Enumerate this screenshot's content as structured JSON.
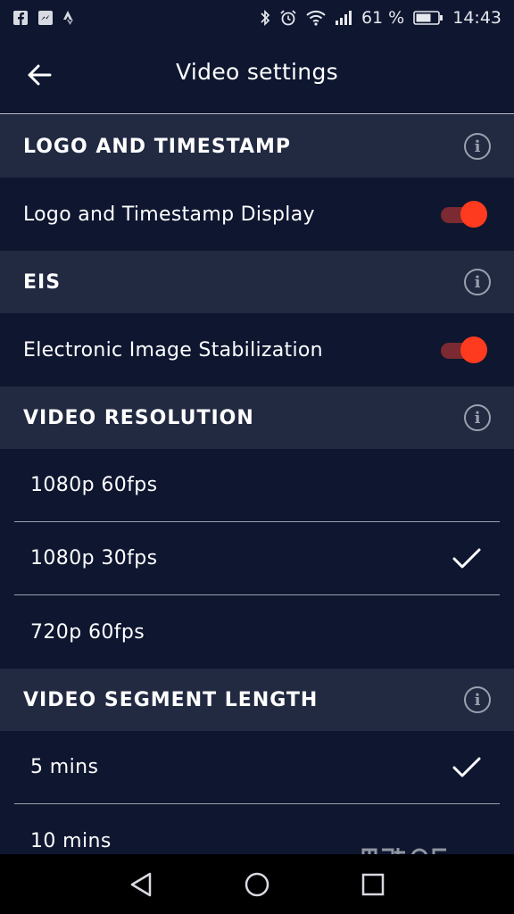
{
  "status_bar": {
    "battery_percent": "61 %",
    "time": "14:43",
    "left_icons": [
      "facebook-icon",
      "messenger-icon",
      "strava-icon"
    ],
    "right_icons": [
      "bluetooth-icon",
      "alarm-icon",
      "wifi-icon",
      "signal-icon",
      "battery-icon"
    ]
  },
  "header": {
    "title": "Video settings",
    "back_icon": "back-arrow-icon"
  },
  "sections": {
    "logo": {
      "title": "LOGO AND TIMESTAMP",
      "info_glyph": "i",
      "toggle_label": "Logo and Timestamp Display",
      "toggle_on": true
    },
    "eis": {
      "title": "EIS",
      "info_glyph": "i",
      "toggle_label": "Electronic Image Stabilization",
      "toggle_on": true
    },
    "resolution": {
      "title": "VIDEO RESOLUTION",
      "info_glyph": "i",
      "options": [
        "1080p 60fps",
        "1080p 30fps",
        "720p 60fps"
      ],
      "selected": "1080p 30fps"
    },
    "segment": {
      "title": "VIDEO SEGMENT LENGTH",
      "info_glyph": "i",
      "options": [
        "5 mins",
        "10 mins"
      ],
      "selected": "5 mins"
    }
  },
  "nav_bar": {
    "icons": [
      "back-triangle-icon",
      "home-circle-icon",
      "recents-square-icon"
    ]
  },
  "colors": {
    "background": "#0e1630",
    "section_header": "#222a42",
    "toggle_thumb": "#ff3b1f",
    "toggle_track": "#7a2a30",
    "divider": "#9aa0ae"
  },
  "watermark": {
    "text": "matos VELO",
    "icon": "matos-velo-logo"
  }
}
